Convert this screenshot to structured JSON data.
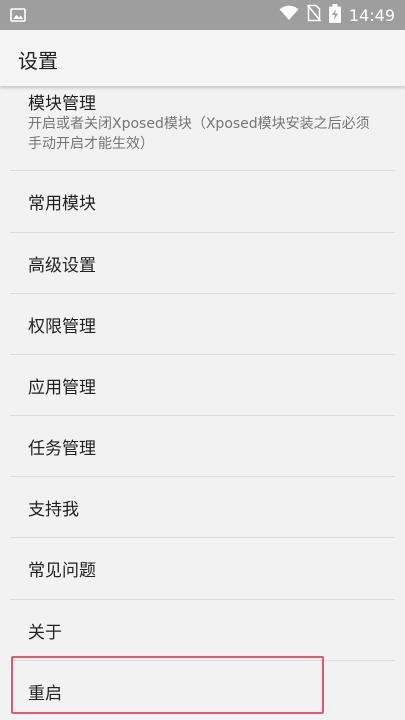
{
  "status_bar": {
    "time": "14:49",
    "icons": [
      "image-icon",
      "wifi-icon",
      "no-sim-icon",
      "battery-charging-icon"
    ]
  },
  "app_bar": {
    "title": "设置"
  },
  "settings": {
    "first_item": {
      "title": "模块管理",
      "description": "开启或者关闭Xposed模块（Xposed模块安装之后必须手动开启才能生效）"
    },
    "items": [
      {
        "label": "常用模块"
      },
      {
        "label": "高级设置"
      },
      {
        "label": "权限管理"
      },
      {
        "label": "应用管理"
      },
      {
        "label": "任务管理"
      },
      {
        "label": "支持我"
      },
      {
        "label": "常见问题"
      },
      {
        "label": "关于"
      },
      {
        "label": "重启",
        "highlighted": true
      }
    ]
  },
  "colors": {
    "status_bar": "#9e9e9e",
    "background": "#f2f2f2",
    "highlight_border": "#e35a6b"
  }
}
